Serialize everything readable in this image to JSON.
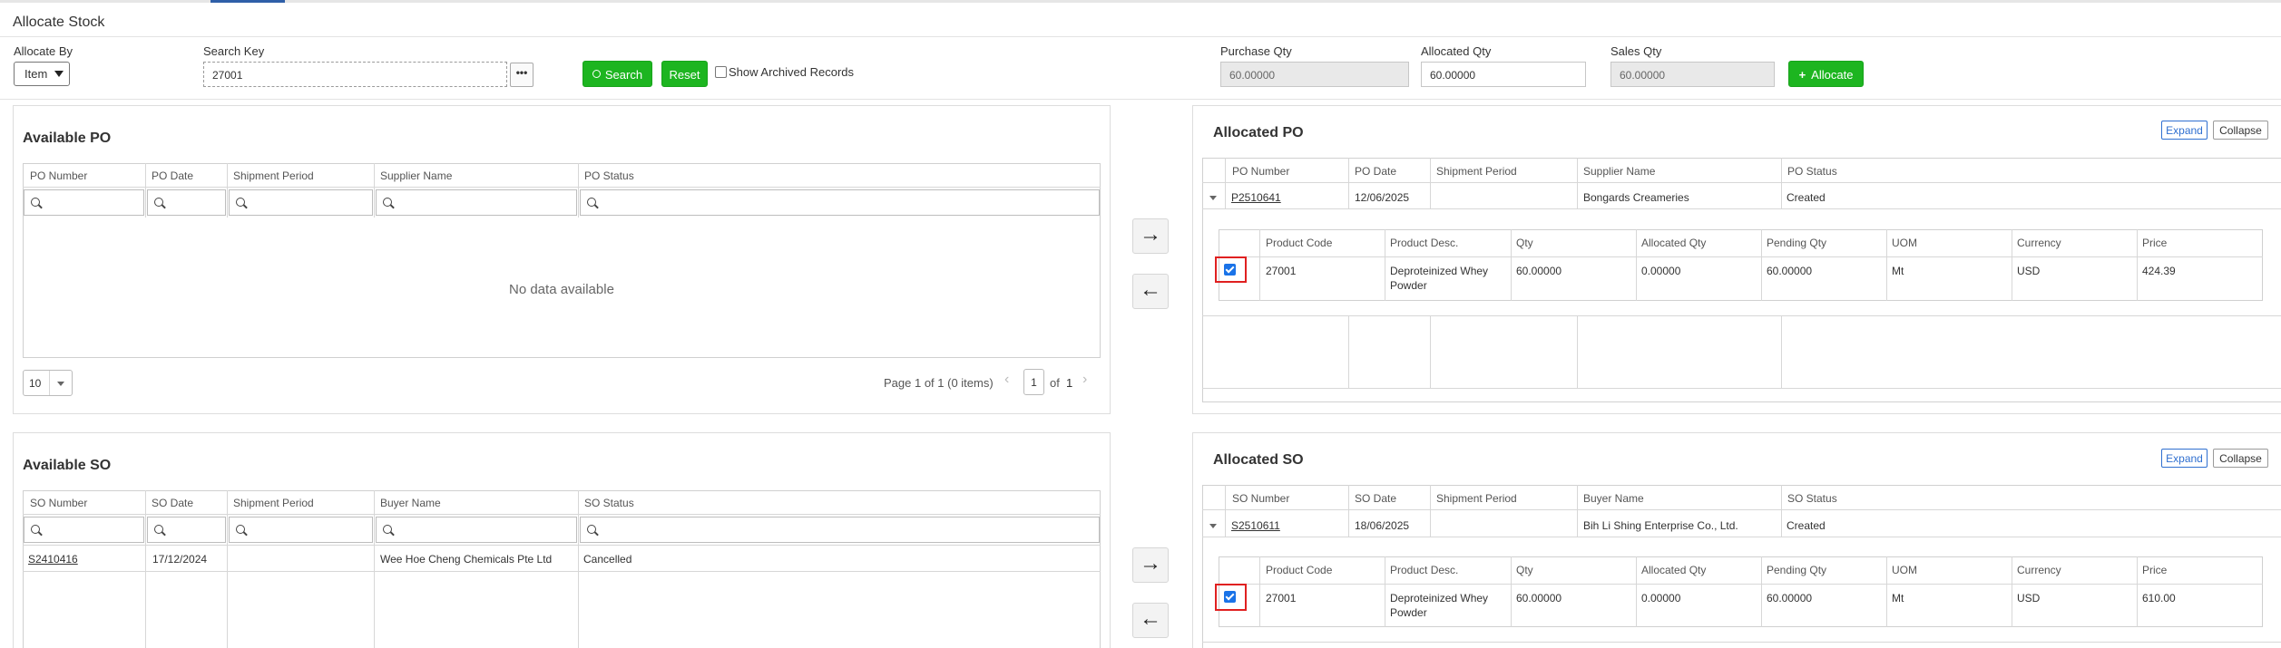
{
  "page": {
    "title": "Allocate Stock"
  },
  "filters": {
    "allocate_by_label": "Allocate By",
    "allocate_by_value": "Item",
    "search_key_label": "Search Key",
    "search_key_value": "27001",
    "browse_label": "•••",
    "search_button": "Search",
    "reset_button": "Reset",
    "archived_label": "Show Archived Records",
    "purchase_qty_label": "Purchase Qty",
    "purchase_qty_value": "60.00000",
    "allocated_qty_label": "Allocated Qty",
    "allocated_qty_value": "60.00000",
    "sales_qty_label": "Sales Qty",
    "sales_qty_value": "60.00000",
    "allocate_button": "Allocate"
  },
  "available_po": {
    "title": "Available PO",
    "columns": [
      "PO Number",
      "PO Date",
      "Shipment Period",
      "Supplier Name",
      "PO Status"
    ],
    "no_data": "No data available",
    "page_size": "10",
    "page_info": "Page 1 of 1 (0 items)",
    "page_current": "1",
    "page_of": "of",
    "page_total": "1"
  },
  "available_so": {
    "title": "Available SO",
    "columns": [
      "SO Number",
      "SO Date",
      "Shipment Period",
      "Buyer Name",
      "SO Status"
    ],
    "rows": [
      {
        "number": "S2410416",
        "date": "17/12/2024",
        "period": "",
        "name": "Wee Hoe Cheng Chemicals Pte Ltd",
        "status": "Cancelled"
      }
    ]
  },
  "transfer": {
    "right_arrow": "→",
    "left_arrow": "←"
  },
  "allocated_po": {
    "title": "Allocated PO",
    "expand": "Expand",
    "collapse": "Collapse",
    "columns": [
      "PO Number",
      "PO Date",
      "Shipment Period",
      "Supplier Name",
      "PO Status"
    ],
    "row": {
      "number": "P2510641",
      "date": "12/06/2025",
      "period": "",
      "name": "Bongards Creameries",
      "status": "Created"
    },
    "detail_columns": [
      "Product Code",
      "Product Desc.",
      "Qty",
      "Allocated Qty",
      "Pending Qty",
      "UOM",
      "Currency",
      "Price"
    ],
    "detail_row": {
      "code": "27001",
      "desc": "Deproteinized Whey Powder",
      "qty": "60.00000",
      "allocated": "0.00000",
      "pending": "60.00000",
      "uom": "Mt",
      "currency": "USD",
      "price": "424.39",
      "checked": true
    }
  },
  "allocated_so": {
    "title": "Allocated SO",
    "expand": "Expand",
    "collapse": "Collapse",
    "columns": [
      "SO Number",
      "SO Date",
      "Shipment Period",
      "Buyer Name",
      "SO Status"
    ],
    "row": {
      "number": "S2510611",
      "date": "18/06/2025",
      "period": "",
      "name": "Bih Li Shing Enterprise Co., Ltd.",
      "status": "Created"
    },
    "detail_columns": [
      "Product Code",
      "Product Desc.",
      "Qty",
      "Allocated Qty",
      "Pending Qty",
      "UOM",
      "Currency",
      "Price"
    ],
    "detail_row": {
      "code": "27001",
      "desc": "Deproteinized Whey Powder",
      "qty": "60.00000",
      "allocated": "0.00000",
      "pending": "60.00000",
      "uom": "Mt",
      "currency": "USD",
      "price": "610.00",
      "checked": true
    }
  },
  "icons": {
    "search": "search-icon",
    "plus": "plus-icon",
    "caret": "chevron-down-icon"
  }
}
